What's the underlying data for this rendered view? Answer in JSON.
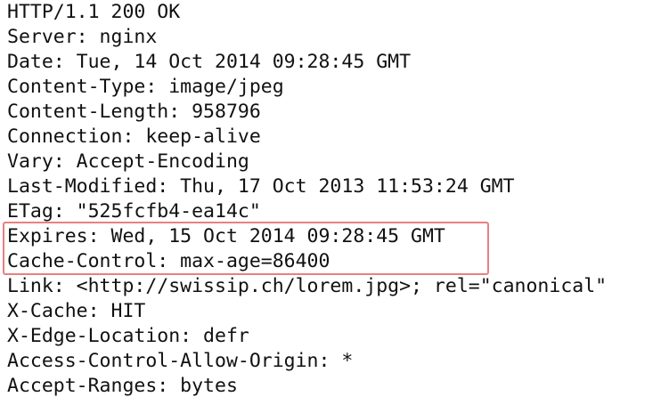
{
  "response": {
    "lines": [
      "HTTP/1.1 200 OK",
      "Server: nginx",
      "Date: Tue, 14 Oct 2014 09:28:45 GMT",
      "Content-Type: image/jpeg",
      "Content-Length: 958796",
      "Connection: keep-alive",
      "Vary: Accept-Encoding",
      "Last-Modified: Thu, 17 Oct 2013 11:53:24 GMT",
      "ETag: \"525fcfb4-ea14c\"",
      "Expires: Wed, 15 Oct 2014 09:28:45 GMT",
      "Cache-Control: max-age=86400",
      "Link: <http://swissip.ch/lorem.jpg>; rel=\"canonical\"",
      "X-Cache: HIT",
      "X-Edge-Location: defr",
      "Access-Control-Allow-Origin: *",
      "Accept-Ranges: bytes"
    ]
  },
  "colors": {
    "text": "#111111",
    "background": "#ffffff",
    "highlight_border": "#e98080"
  }
}
